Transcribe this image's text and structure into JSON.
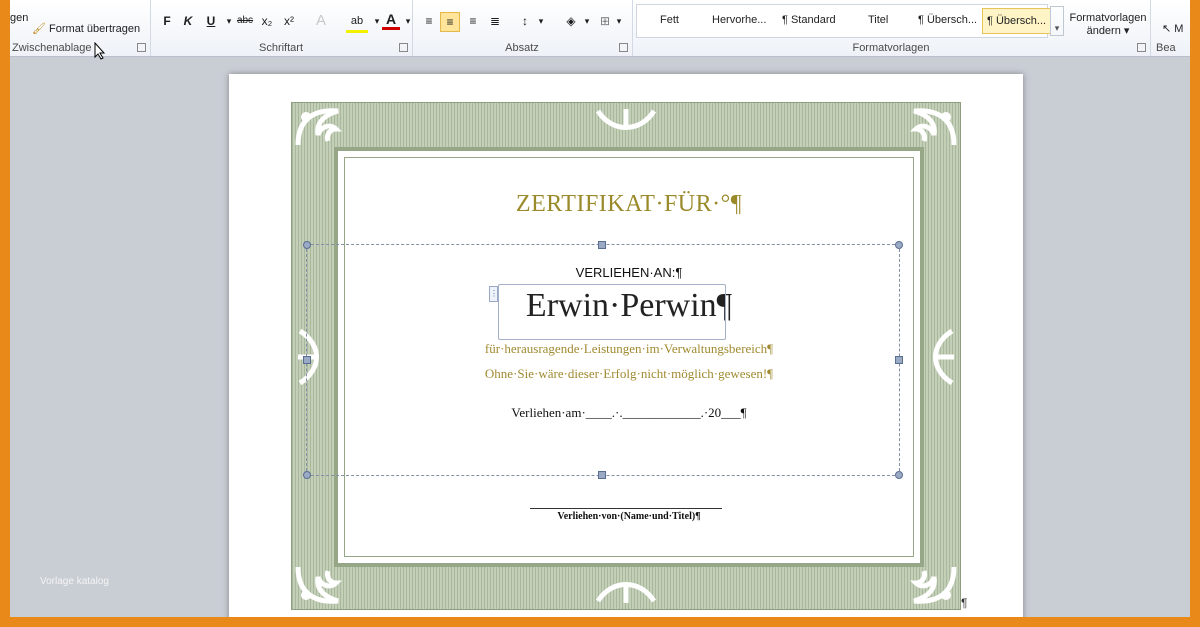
{
  "ribbon": {
    "clipboard": {
      "partial_left_label": "gen",
      "format_painter_label": "Format übertragen",
      "group_label": "Zwischenablage"
    },
    "font": {
      "bold": "F",
      "italic": "K",
      "underline": "U",
      "strike": "abc",
      "subscript": "x₂",
      "superscript": "x²",
      "text_effects": "A",
      "highlight": "ab",
      "font_color": "A",
      "group_label": "Schriftart"
    },
    "paragraph": {
      "group_label": "Absatz"
    },
    "styles": {
      "items": [
        "Fett",
        "Hervorhe...",
        "¶ Standard",
        "Titel",
        "¶ Übersch...",
        "¶ Übersch..."
      ],
      "change_styles_label_1": "Formatvorlagen",
      "change_styles_label_2": "ändern ▾",
      "group_label": "Formatvorlagen"
    },
    "editing": {
      "partial_label": "M",
      "group_label": "Bea"
    }
  },
  "document": {
    "title": "ZERTIFIKAT·FÜR·°¶",
    "awarded_to": "VERLIEHEN·AN:¶",
    "recipient": "Erwin·Perwin¶",
    "line1": "für·herausragende·Leistungen·im·Verwaltungsbereich¶",
    "line2": "Ohne·Sie·wäre·dieser·Erfolg·nicht·möglich·gewesen!¶",
    "date_line": "Verliehen·am·____.·.____________.·20___¶",
    "signature_label": "Verliehen·von·(Name·und·Titel)¶",
    "pilcrow_top": "¶",
    "pilcrow_bottom": "¶"
  },
  "watermark": "Vorlage katalog",
  "colors": {
    "title_gold": "#9a8a2a",
    "accent_olive": "#a08a30",
    "border_green": "#95a786"
  }
}
